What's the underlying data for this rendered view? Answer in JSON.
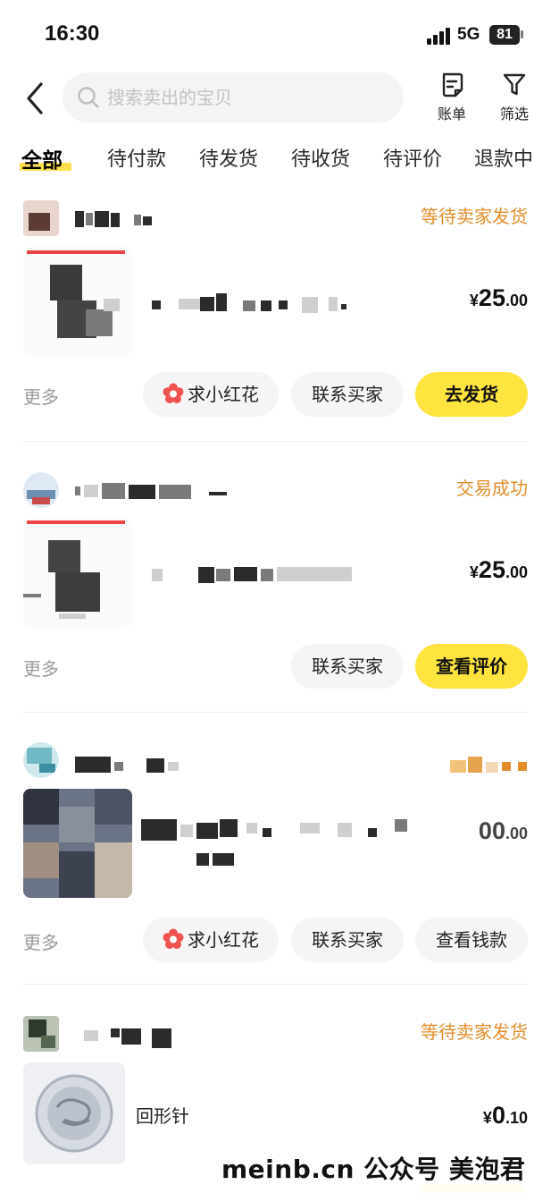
{
  "status_bar": {
    "time": "16:30",
    "network": "5G",
    "battery": "81"
  },
  "header": {
    "search_placeholder": "搜索卖出的宝贝",
    "bill_label": "账单",
    "filter_label": "筛选"
  },
  "tabs": [
    "全部",
    "待付款",
    "待发货",
    "待收货",
    "待评价",
    "退款中"
  ],
  "orders": [
    {
      "status": "等待卖家发货",
      "price": {
        "symbol": "¥",
        "int": "25",
        "dec": ".00"
      },
      "more_label": "更多",
      "buttons": [
        "求小红花",
        "联系买家",
        "去发货"
      ]
    },
    {
      "status": "交易成功",
      "price": {
        "symbol": "¥",
        "int": "25",
        "dec": ".00"
      },
      "more_label": "更多",
      "buttons": [
        "联系买家",
        "查看评价"
      ]
    },
    {
      "price": {
        "int": "00",
        "dec": ".00"
      },
      "more_label": "更多",
      "buttons": [
        "求小红花",
        "联系买家",
        "查看钱款"
      ]
    },
    {
      "status": "等待卖家发货",
      "title": "回形针",
      "price": {
        "symbol": "¥",
        "int": "0",
        "dec": ".10"
      }
    }
  ],
  "watermark": "meinb.cn  公众号 美泡君",
  "colors": {
    "accent": "#ffe33e",
    "status_orange": "#e38e2b",
    "more_gray": "#9a9a9a"
  }
}
